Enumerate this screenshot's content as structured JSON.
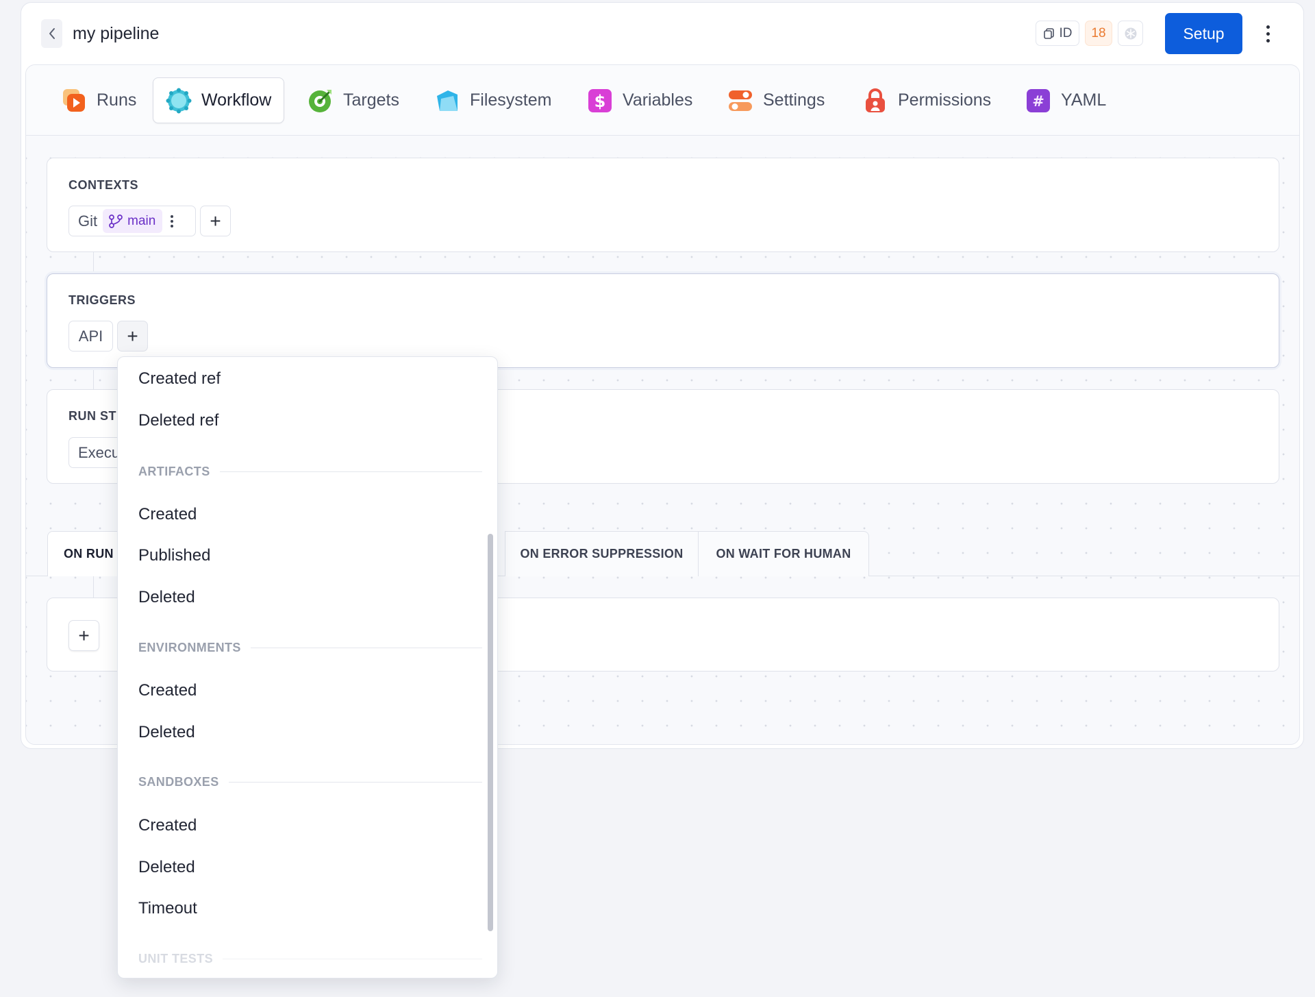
{
  "header": {
    "title": "my pipeline",
    "id_label": "ID",
    "count_badge": "18",
    "setup_label": "Setup"
  },
  "tabs": [
    {
      "label": "Runs",
      "icon": "runs-icon"
    },
    {
      "label": "Workflow",
      "icon": "workflow-icon",
      "active": true
    },
    {
      "label": "Targets",
      "icon": "targets-icon"
    },
    {
      "label": "Filesystem",
      "icon": "filesystem-icon"
    },
    {
      "label": "Variables",
      "icon": "variables-icon"
    },
    {
      "label": "Settings",
      "icon": "settings-icon"
    },
    {
      "label": "Permissions",
      "icon": "permissions-icon"
    },
    {
      "label": "YAML",
      "icon": "yaml-icon"
    }
  ],
  "contexts": {
    "title": "CONTEXTS",
    "git_label": "Git",
    "branch": "main"
  },
  "triggers": {
    "title": "TRIGGERS",
    "api_label": "API"
  },
  "run_steps": {
    "title_visible": "RUN ST",
    "chip_visible": "Execu"
  },
  "bottom_tabs": [
    {
      "label": "ON RUN",
      "active": true
    },
    {
      "label": "ON ERROR SUPPRESSION"
    },
    {
      "label": "ON WAIT FOR HUMAN"
    }
  ],
  "dropdown": {
    "items": [
      {
        "type": "item",
        "label": "Created ref"
      },
      {
        "type": "item",
        "label": "Deleted ref"
      },
      {
        "type": "group",
        "label": "ARTIFACTS"
      },
      {
        "type": "item",
        "label": "Created"
      },
      {
        "type": "item",
        "label": "Published"
      },
      {
        "type": "item",
        "label": "Deleted"
      },
      {
        "type": "group",
        "label": "ENVIRONMENTS"
      },
      {
        "type": "item",
        "label": "Created"
      },
      {
        "type": "item",
        "label": "Deleted"
      },
      {
        "type": "group",
        "label": "SANDBOXES"
      },
      {
        "type": "item",
        "label": "Created"
      },
      {
        "type": "item",
        "label": "Deleted"
      },
      {
        "type": "item",
        "label": "Timeout"
      },
      {
        "type": "group",
        "label": "UNIT TESTS"
      }
    ]
  },
  "colors": {
    "primary": "#0d5ddc",
    "branch_badge": "#6a2fc7",
    "count_badge": "#ea7a30"
  }
}
